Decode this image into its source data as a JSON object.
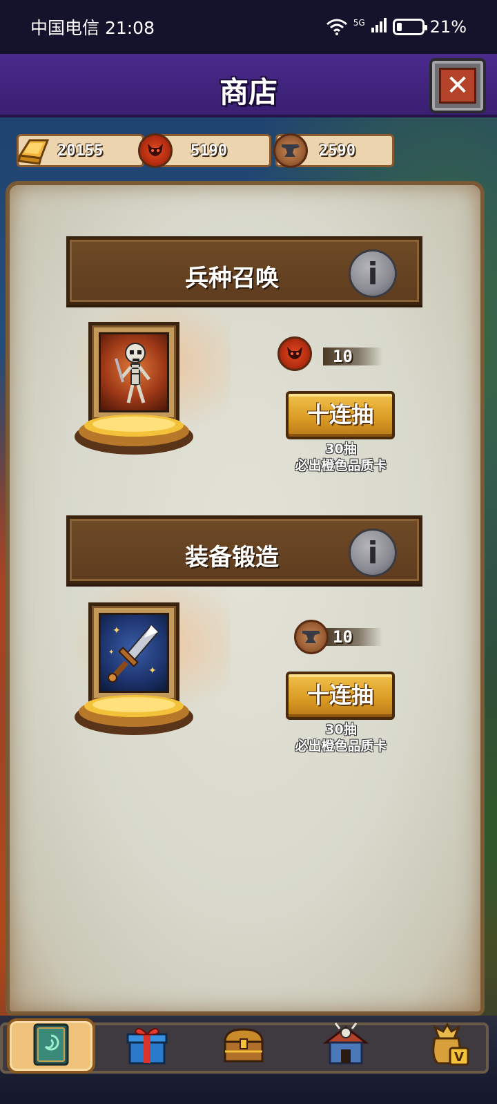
{
  "status_bar": {
    "carrier_time": "中国电信 21:08",
    "network": "5G",
    "battery": "21%",
    "battery_level": 0.21
  },
  "header": {
    "title": "商店",
    "close_icon": "close-icon"
  },
  "currencies": [
    {
      "icon": "gold-bar-icon",
      "value": "20155",
      "color": "#f1b21f"
    },
    {
      "icon": "demon-coin-icon",
      "value": "5190",
      "color": "#d43a18"
    },
    {
      "icon": "anvil-coin-icon",
      "value": "2590",
      "color": "#9b5e34"
    }
  ],
  "sections": [
    {
      "title": "兵种召唤",
      "info_icon": "info-icon",
      "card_art": "skeleton-warrior-icon",
      "cost_icon": "demon-coin-icon",
      "cost_value": "10",
      "button_label": "十连抽",
      "note_line1": "30抽",
      "note_line2": "必出橙色品质卡"
    },
    {
      "title": "装备锻造",
      "info_icon": "info-icon",
      "card_art": "sword-icon",
      "cost_icon": "anvil-coin-icon",
      "cost_value": "10",
      "button_label": "十连抽",
      "note_line1": "30抽",
      "note_line2": "必出橙色品质卡"
    }
  ],
  "bottom_nav": [
    {
      "icon": "card-deck-icon",
      "active": true
    },
    {
      "icon": "gift-box-icon",
      "active": false
    },
    {
      "icon": "treasure-chest-icon",
      "active": false
    },
    {
      "icon": "barracks-icon",
      "active": false
    },
    {
      "icon": "vip-bag-icon",
      "active": false
    }
  ]
}
